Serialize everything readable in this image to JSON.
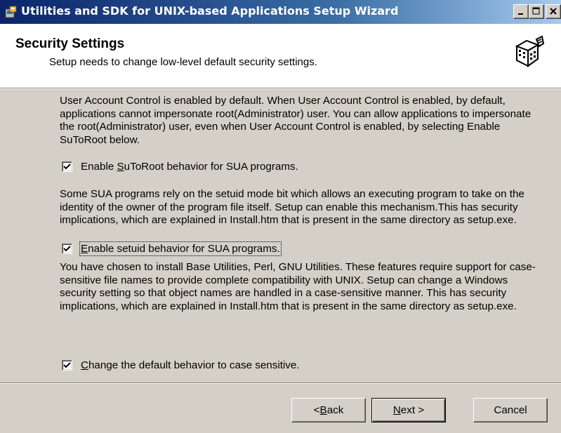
{
  "window": {
    "title": "Utilities and SDK for UNIX-based Applications Setup Wizard",
    "title_bar_color": "#0a246a",
    "face_color": "#d4d0c8"
  },
  "header": {
    "title": "Security Settings",
    "subtitle": "Setup needs to change low-level default security settings.",
    "logo_icon": "setup-wizard-icon"
  },
  "content": {
    "paragraph1": "User Account Control is enabled by default. When User Account Control is enabled, by default, applications cannot impersonate root(Administrator) user. You can allow applications to impersonate the root(Administrator) user, even when User Account Control is enabled, by selecting Enable SuToRoot below.",
    "checkbox1": {
      "pre": "Enable ",
      "accel": "S",
      "post": "uToRoot behavior for SUA programs.",
      "checked": true
    },
    "paragraph2": "Some SUA programs rely on the setuid mode bit which allows an executing program to take on the identity of the owner of the program file itself. Setup can enable this mechanism.This has security implications, which are explained in Install.htm that is present in the same directory as setup.exe.",
    "checkbox2": {
      "pre": "",
      "accel": "E",
      "post": "nable setuid behavior for SUA programs.",
      "checked": true
    },
    "paragraph3": "You have chosen to install Base Utilities, Perl, GNU Utilities. These features require support for case-sensitive file names to provide complete compatibility with UNIX. Setup can change a Windows security setting so that object names are handled in a case-sensitive manner. This has security implications, which are explained in Install.htm that is present in the same directory as setup.exe.",
    "checkbox3": {
      "pre": "",
      "accel": "C",
      "post": "hange the default behavior to case sensitive.",
      "checked": true
    }
  },
  "footer": {
    "back": {
      "pre": "< ",
      "accel": "B",
      "post": "ack"
    },
    "next": {
      "pre": "",
      "accel": "N",
      "post": "ext >"
    },
    "cancel": "Cancel"
  }
}
